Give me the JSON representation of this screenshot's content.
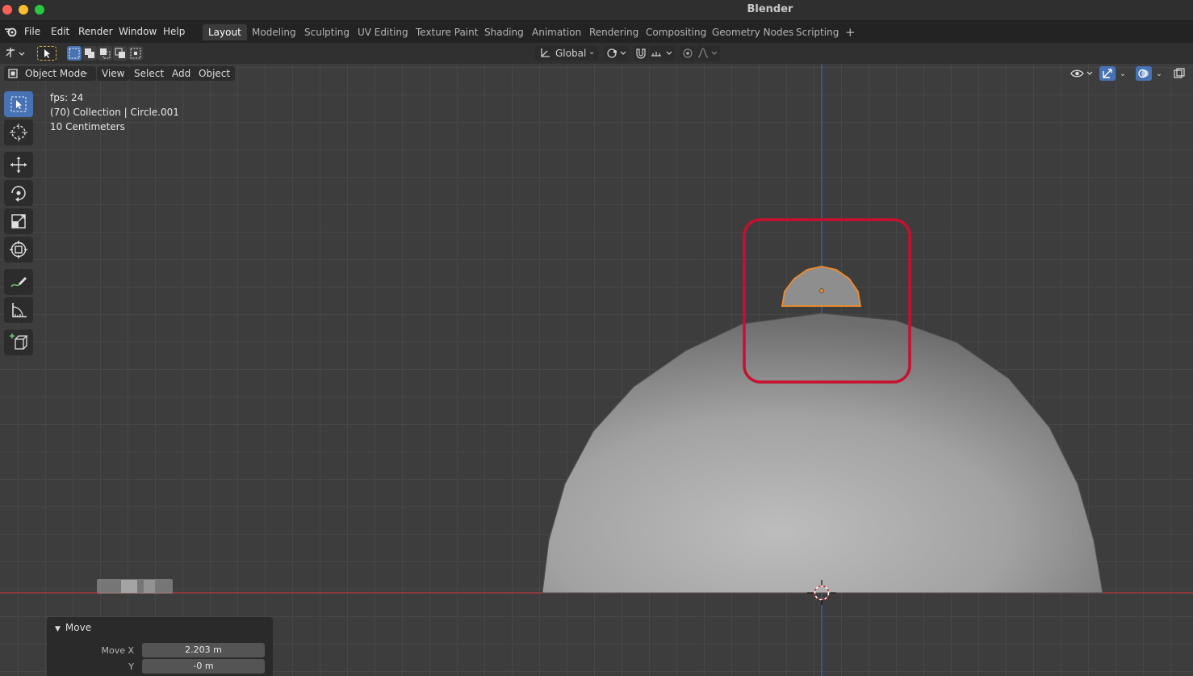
{
  "app_title": "Blender",
  "menu": {
    "logo": "blender-logo-icon",
    "items": [
      "File",
      "Edit",
      "Render",
      "Window",
      "Help"
    ]
  },
  "workspaces": [
    {
      "label": "Layout",
      "active": true
    },
    {
      "label": "Modeling"
    },
    {
      "label": "Sculpting"
    },
    {
      "label": "UV Editing"
    },
    {
      "label": "Texture Paint"
    },
    {
      "label": "Shading"
    },
    {
      "label": "Animation"
    },
    {
      "label": "Rendering"
    },
    {
      "label": "Compositing"
    },
    {
      "label": "Geometry Nodes"
    },
    {
      "label": "Scripting"
    }
  ],
  "add_workspace": "+",
  "header": {
    "orientation": "Global"
  },
  "viewport_header": {
    "mode": "Object Mode",
    "menus": [
      "View",
      "Select",
      "Add",
      "Object"
    ]
  },
  "overlay": {
    "fps": "fps: 24",
    "collection": "(70) Collection | Circle.001",
    "scale": "10 Centimeters"
  },
  "tools": [
    {
      "name": "select-box-tool",
      "icon": "cursor-box-icon",
      "active": true
    },
    {
      "name": "cursor-tool",
      "icon": "3d-cursor-icon"
    },
    {
      "name": "move-tool",
      "icon": "move-arrows-icon"
    },
    {
      "name": "rotate-tool",
      "icon": "rotate-icon"
    },
    {
      "name": "scale-tool",
      "icon": "scale-icon"
    },
    {
      "name": "transform-tool",
      "icon": "transform-icon"
    },
    {
      "name": "annotate-tool",
      "icon": "pencil-icon"
    },
    {
      "name": "measure-tool",
      "icon": "ruler-icon"
    },
    {
      "name": "add-cube-tool",
      "icon": "add-cube-icon"
    }
  ],
  "move_panel": {
    "title": "Move",
    "fields": [
      {
        "label": "Move X",
        "value": "2.203 m"
      },
      {
        "label": "Y",
        "value": "-0 m"
      }
    ]
  },
  "colors": {
    "accent": "#4772b3",
    "selection": "#f28c28",
    "highlight_box": "#c8102e",
    "x_axis": "#c0392b",
    "z_axis": "#2c6ab8"
  }
}
